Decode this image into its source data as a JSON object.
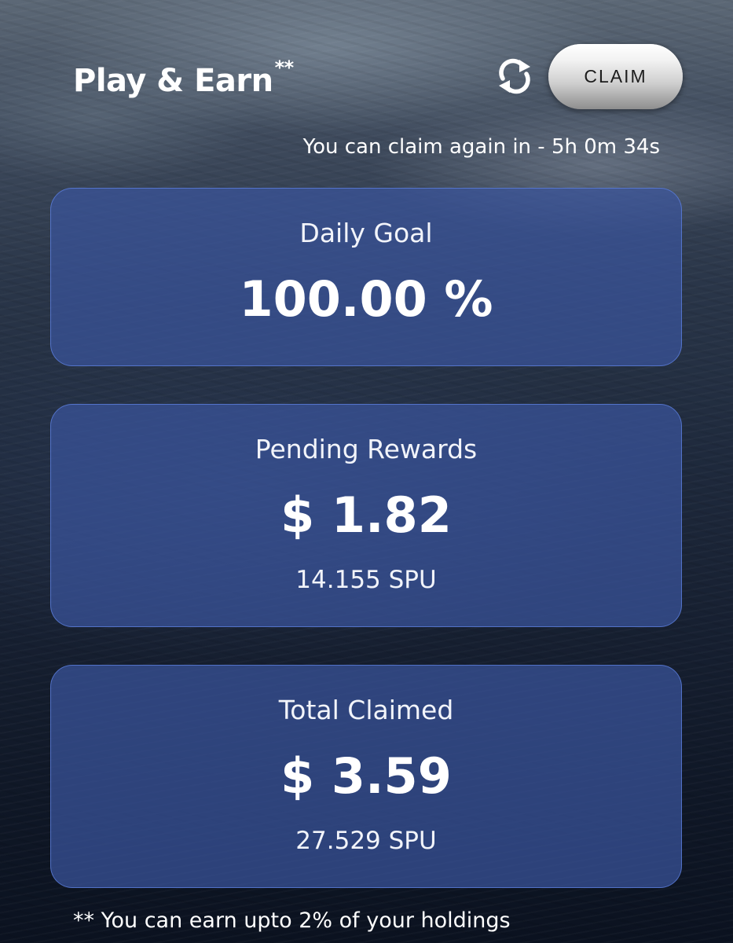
{
  "header": {
    "title": "Play & Earn",
    "title_mark": "**",
    "refresh_icon": "refresh-icon",
    "claim_label": "CLAIM",
    "cooldown_text": "You can claim again in - 5h 0m 34s"
  },
  "cards": {
    "daily_goal": {
      "label": "Daily Goal",
      "value": "100.00 %"
    },
    "pending_rewards": {
      "label": "Pending Rewards",
      "value": "$ 1.82",
      "sub": "14.155 SPU"
    },
    "total_claimed": {
      "label": "Total Claimed",
      "value": "$ 3.59",
      "sub": "27.529 SPU"
    }
  },
  "footnote": "** You can earn upto 2% of your holdings",
  "colors": {
    "card_fill": "#3a549c",
    "card_border": "#5f82e1",
    "text": "#ffffff",
    "button_text": "#1c1c1c"
  }
}
